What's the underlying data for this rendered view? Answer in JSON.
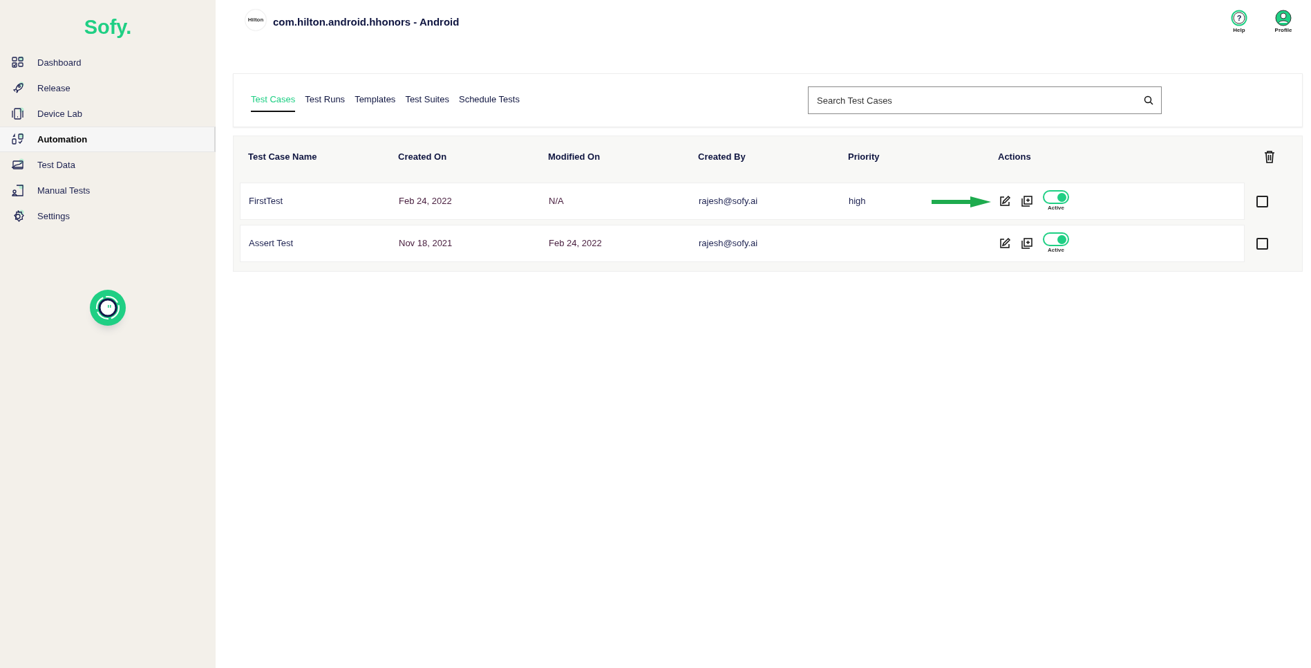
{
  "sidebar": {
    "logo": "Sofy.",
    "items": [
      {
        "label": "Dashboard",
        "selected": false
      },
      {
        "label": "Release",
        "selected": false
      },
      {
        "label": "Device Lab",
        "selected": false
      },
      {
        "label": "Automation",
        "selected": true
      },
      {
        "label": "Test Data",
        "selected": false
      },
      {
        "label": "Manual Tests",
        "selected": false
      },
      {
        "label": "Settings",
        "selected": false
      }
    ]
  },
  "header": {
    "app_logo": "Hilton",
    "title": "com.hilton.android.hhonors - Android",
    "actions": [
      {
        "label": "Help",
        "kind": "help",
        "symbol": "?"
      },
      {
        "label": "Profile",
        "kind": "profile"
      }
    ]
  },
  "tabs": [
    {
      "label": "Test Cases",
      "selected": true
    },
    {
      "label": "Test Runs",
      "selected": false
    },
    {
      "label": "Templates",
      "selected": false
    },
    {
      "label": "Test Suites",
      "selected": false
    },
    {
      "label": "Schedule Tests",
      "selected": false
    }
  ],
  "search": {
    "placeholder": "Search Test Cases"
  },
  "table": {
    "columns": [
      "Test Case Name",
      "Created On",
      "Modified On",
      "Created By",
      "Priority",
      "Actions"
    ],
    "rows": [
      {
        "name": "FirstTest",
        "created_on": "Feb 24, 2022",
        "modified_on": "N/A",
        "created_by": "rajesh@sofy.ai",
        "priority": "high",
        "on": true,
        "status": "Active",
        "checked": false,
        "highlighted": true
      },
      {
        "name": "Assert Test",
        "created_on": "Nov 18, 2021",
        "modified_on": "Feb 24, 2022",
        "created_by": "rajesh@sofy.ai",
        "on": true,
        "status": "Active",
        "checked": false,
        "highlighted": false
      }
    ]
  }
}
